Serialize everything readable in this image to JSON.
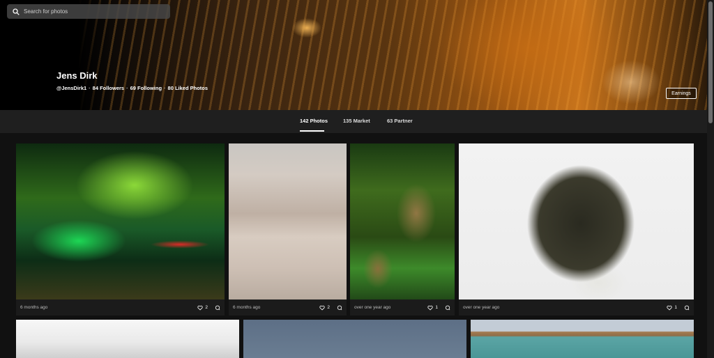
{
  "search": {
    "placeholder": "Search for photos"
  },
  "profile": {
    "name": "Jens Dirk",
    "handle": "@JensDirk1",
    "followers": "84 Followers",
    "following": "69 Following",
    "liked": "80 Liked Photos",
    "earnings_label": "Earnings"
  },
  "tabs": [
    {
      "label": "142 Photos",
      "active": true
    },
    {
      "label": "135 Market",
      "active": false
    },
    {
      "label": "63 Partner",
      "active": false
    }
  ],
  "photos": [
    {
      "time": "6 months ago",
      "likes": "2"
    },
    {
      "time": "6 months ago",
      "likes": "2"
    },
    {
      "time": "over one year ago",
      "likes": "1"
    },
    {
      "time": "over one year ago",
      "likes": "1"
    }
  ],
  "icons": {
    "search": "search-icon",
    "like": "heart-icon",
    "comment": "comment-icon"
  }
}
